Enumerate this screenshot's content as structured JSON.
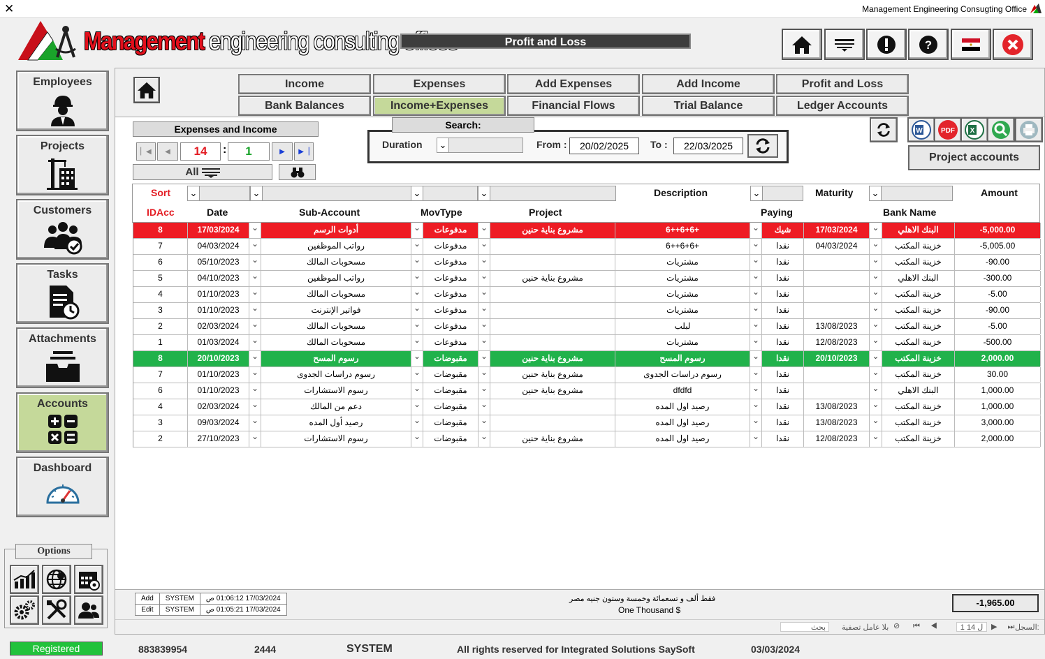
{
  "window": {
    "title": "Management Engineering Consugting Office"
  },
  "brand": {
    "part1": "Management",
    "part2": " engineering consulting offices"
  },
  "page_title": "Profit and Loss",
  "sidebar": [
    {
      "label": "Employees"
    },
    {
      "label": "Projects"
    },
    {
      "label": "Customers"
    },
    {
      "label": "Tasks"
    },
    {
      "label": "Attachments"
    },
    {
      "label": "Accounts"
    },
    {
      "label": "Dashboard"
    }
  ],
  "options_label": "Options",
  "tabs_row1": [
    "Income",
    "Expenses",
    "Add Expenses",
    "Add Income",
    "Profit and Loss"
  ],
  "tabs_row2": [
    "Bank Balances",
    "Income+Expenses",
    "Financial Flows",
    "Trial Balance",
    "Ledger Accounts"
  ],
  "section_title": "Expenses and Income",
  "record_nav": {
    "current": "14",
    "second": "1",
    "sep": ":",
    "filter_label": "All"
  },
  "search": {
    "title": "Search:",
    "duration_label": "Duration",
    "from_label": "From :",
    "from_value": "20/02/2025",
    "to_label": "To :",
    "to_value": "22/03/2025"
  },
  "project_accounts_label": "Project accounts",
  "grid_header": {
    "sort": "Sort",
    "description": "Description",
    "maturity": "Maturity",
    "amount": "Amount",
    "idacc": "IDAcc",
    "date": "Date",
    "sub_account": "Sub-Account",
    "movtype": "MovType",
    "project": "Project",
    "paying": "Paying",
    "bank": "Bank Name"
  },
  "rows": [
    {
      "id": "8",
      "date": "17/03/2024",
      "sub": "أدوات الرسم",
      "mov": "مدفوعات",
      "proj": "مشروع بناية حنين",
      "desc": "+6+6++6",
      "pay": "شيك",
      "mat": "17/03/2024",
      "bank": "البنك الاهلي",
      "amt": "-5,000.00",
      "hl": "red"
    },
    {
      "id": "7",
      "date": "04/03/2024",
      "sub": "رواتب الموظفين",
      "mov": "مدفوعات",
      "proj": "",
      "desc": "+6+6++6",
      "pay": "نقدا",
      "mat": "04/03/2024",
      "bank": "خزينة المكتب",
      "amt": "-5,005.00",
      "hl": ""
    },
    {
      "id": "6",
      "date": "05/10/2023",
      "sub": "مسحوبات المالك",
      "mov": "مدفوعات",
      "proj": "",
      "desc": "مشتريات",
      "pay": "نقدا",
      "mat": "",
      "bank": "خزينة المكتب",
      "amt": "-90.00",
      "hl": ""
    },
    {
      "id": "5",
      "date": "04/10/2023",
      "sub": "رواتب الموظفين",
      "mov": "مدفوعات",
      "proj": "مشروع بناية حنين",
      "desc": "مشتريات",
      "pay": "نقدا",
      "mat": "",
      "bank": "البنك الاهلي",
      "amt": "-300.00",
      "hl": ""
    },
    {
      "id": "4",
      "date": "01/10/2023",
      "sub": "مسحوبات المالك",
      "mov": "مدفوعات",
      "proj": "",
      "desc": "مشتريات",
      "pay": "نقدا",
      "mat": "",
      "bank": "خزينة المكتب",
      "amt": "-5.00",
      "hl": ""
    },
    {
      "id": "3",
      "date": "01/10/2023",
      "sub": "فواتير الإنترنت",
      "mov": "مدفوعات",
      "proj": "",
      "desc": "مشتريات",
      "pay": "نقدا",
      "mat": "",
      "bank": "خزينة المكتب",
      "amt": "-90.00",
      "hl": ""
    },
    {
      "id": "2",
      "date": "02/03/2024",
      "sub": "مسحوبات المالك",
      "mov": "مدفوعات",
      "proj": "",
      "desc": "لبلب",
      "pay": "نقدا",
      "mat": "13/08/2023",
      "bank": "خزينة المكتب",
      "amt": "-5.00",
      "hl": ""
    },
    {
      "id": "1",
      "date": "01/03/2024",
      "sub": "مسحوبات المالك",
      "mov": "مدفوعات",
      "proj": "",
      "desc": "مشتريات",
      "pay": "نقدا",
      "mat": "12/08/2023",
      "bank": "خزينة المكتب",
      "amt": "-500.00",
      "hl": ""
    },
    {
      "id": "8",
      "date": "20/10/2023",
      "sub": "رسوم المسح",
      "mov": "مقبوضات",
      "proj": "مشروع بناية حنين",
      "desc": "رسوم المسح",
      "pay": "نقدا",
      "mat": "20/10/2023",
      "bank": "خزينة المكتب",
      "amt": "2,000.00",
      "hl": "green"
    },
    {
      "id": "7",
      "date": "01/10/2023",
      "sub": "رسوم دراسات الجدوى",
      "mov": "مقبوضات",
      "proj": "مشروع بناية حنين",
      "desc": "رسوم دراسات الجدوى",
      "pay": "نقدا",
      "mat": "",
      "bank": "خزينة المكتب",
      "amt": "30.00",
      "hl": ""
    },
    {
      "id": "6",
      "date": "01/10/2023",
      "sub": "رسوم الاستشارات",
      "mov": "مقبوضات",
      "proj": "مشروع بناية حنين",
      "desc": "dfdfd",
      "pay": "نقدا",
      "mat": "",
      "bank": "البنك الاهلي",
      "amt": "1,000.00",
      "hl": ""
    },
    {
      "id": "4",
      "date": "02/03/2024",
      "sub": "دعم من المالك",
      "mov": "مقبوضات",
      "proj": "",
      "desc": "رصيد اول المده",
      "pay": "نقدا",
      "mat": "13/08/2023",
      "bank": "خزينة المكتب",
      "amt": "1,000.00",
      "hl": ""
    },
    {
      "id": "3",
      "date": "09/03/2024",
      "sub": "رصيد أول المده",
      "mov": "مقبوضات",
      "proj": "",
      "desc": "رصيد اول المده",
      "pay": "نقدا",
      "mat": "13/08/2023",
      "bank": "خزينة المكتب",
      "amt": "3,000.00",
      "hl": ""
    },
    {
      "id": "2",
      "date": "27/10/2023",
      "sub": "رسوم الاستشارات",
      "mov": "مقبوضات",
      "proj": "مشروع بناية حنين",
      "desc": "رصيد اول المده",
      "pay": "نقدا",
      "mat": "12/08/2023",
      "bank": "خزينة المكتب",
      "amt": "2,000.00",
      "hl": ""
    }
  ],
  "audit": [
    {
      "action": "Add",
      "user": "SYSTEM",
      "time": "17/03/2024 01:06:12 ص"
    },
    {
      "action": "Edit",
      "user": "SYSTEM",
      "time": "17/03/2024 01:05:21 ص"
    }
  ],
  "total": "-1,965.00",
  "total_words_ar": "فقط ألف و تسعمائة وخمسة وستون جنيه مصر",
  "total_words_en": "One Thousand $",
  "record_bar": {
    "label": "السجل:",
    "position": "1 ل 14",
    "no_filter": "بلا عامل تصفية",
    "search": "بحث"
  },
  "status": {
    "registered": "Registered",
    "code": "883839954",
    "num": "2444",
    "user": "SYSTEM",
    "rights": "All rights reserved for Integrated Solutions SaySoft",
    "date": "03/03/2024"
  },
  "colors": {
    "active_green": "#c5d99a",
    "row_red": "#ee1c24",
    "row_green": "#21b24b",
    "brand_red": "#e3101c"
  }
}
